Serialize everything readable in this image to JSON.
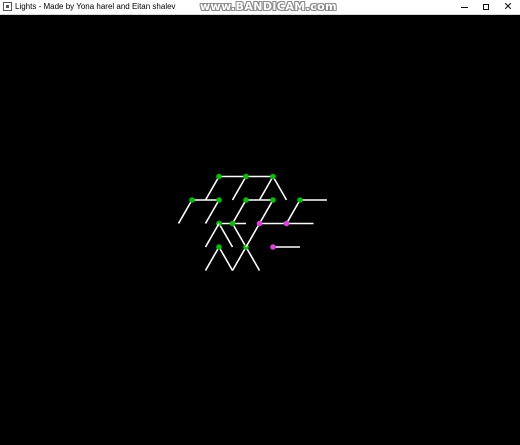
{
  "window": {
    "title": "Lights - Made by Yona harel and Eitan shalev",
    "watermark": "www.BANDICAM.com",
    "controls": {
      "minimize": "minimize",
      "maximize": "maximize",
      "close": "close"
    }
  },
  "colors": {
    "background": "#000000",
    "wire": "#ffffff",
    "lit_bulb": "#00c000",
    "unlit_bulb": "#e040e0"
  },
  "game": {
    "pieces": [
      {
        "id": "p1",
        "state": "lit",
        "segments": [
          [
            -1.5,
            0,
            0
          ],
          [
            -1.5,
            0,
            1
          ]
        ]
      },
      {
        "id": "p2",
        "state": "lit",
        "segments": [
          [
            -0.5,
            0,
            0
          ],
          [
            -0.5,
            0,
            1
          ]
        ]
      },
      {
        "id": "p3",
        "state": "lit",
        "segments": [
          [
            0.5,
            0,
            0
          ],
          [
            0.5,
            0,
            2
          ]
        ]
      },
      {
        "id": "p4",
        "state": "lit",
        "segments": [
          [
            -2.5,
            1,
            1
          ],
          [
            -2.5,
            1,
            0
          ]
        ]
      },
      {
        "id": "p5",
        "state": "lit",
        "segments": [
          [
            -1.5,
            1,
            0
          ]
        ]
      },
      {
        "id": "p6",
        "state": "lit",
        "segments": [
          [
            -0.5,
            1,
            0
          ],
          [
            -0.5,
            1,
            1
          ]
        ]
      },
      {
        "id": "p7",
        "state": "lit",
        "segments": [
          [
            0.5,
            1,
            0
          ]
        ]
      },
      {
        "id": "p8",
        "state": "lit",
        "segments": [
          [
            1.5,
            1,
            0
          ],
          [
            1.5,
            1,
            1
          ]
        ]
      },
      {
        "id": "p9",
        "state": "lit",
        "segments": [
          [
            -1.5,
            2,
            1
          ]
        ]
      },
      {
        "id": "p10",
        "state": "lit",
        "segments": [
          [
            -1.5,
            2,
            2
          ]
        ]
      },
      {
        "id": "p11",
        "state": "lit",
        "segments": [
          [
            -1,
            2,
            2
          ],
          [
            -1.5,
            2,
            0
          ]
        ]
      },
      {
        "id": "p12",
        "state": "lit",
        "segments": [
          [
            -1.5,
            3,
            0
          ],
          [
            -1.5,
            3,
            2
          ]
        ]
      },
      {
        "id": "p13",
        "state": "lit",
        "segments": [
          [
            -0.5,
            3,
            2
          ],
          [
            -0.5,
            3,
            0
          ]
        ]
      },
      {
        "id": "p14",
        "state": "unlit",
        "segments": [
          [
            0,
            2,
            0
          ],
          [
            0,
            2,
            1
          ]
        ]
      },
      {
        "id": "p15",
        "state": "unlit",
        "segments": [
          [
            1,
            2,
            1
          ]
        ]
      },
      {
        "id": "p16",
        "state": "unlit",
        "segments": [
          [
            0.5,
            3,
            1
          ]
        ]
      }
    ]
  }
}
